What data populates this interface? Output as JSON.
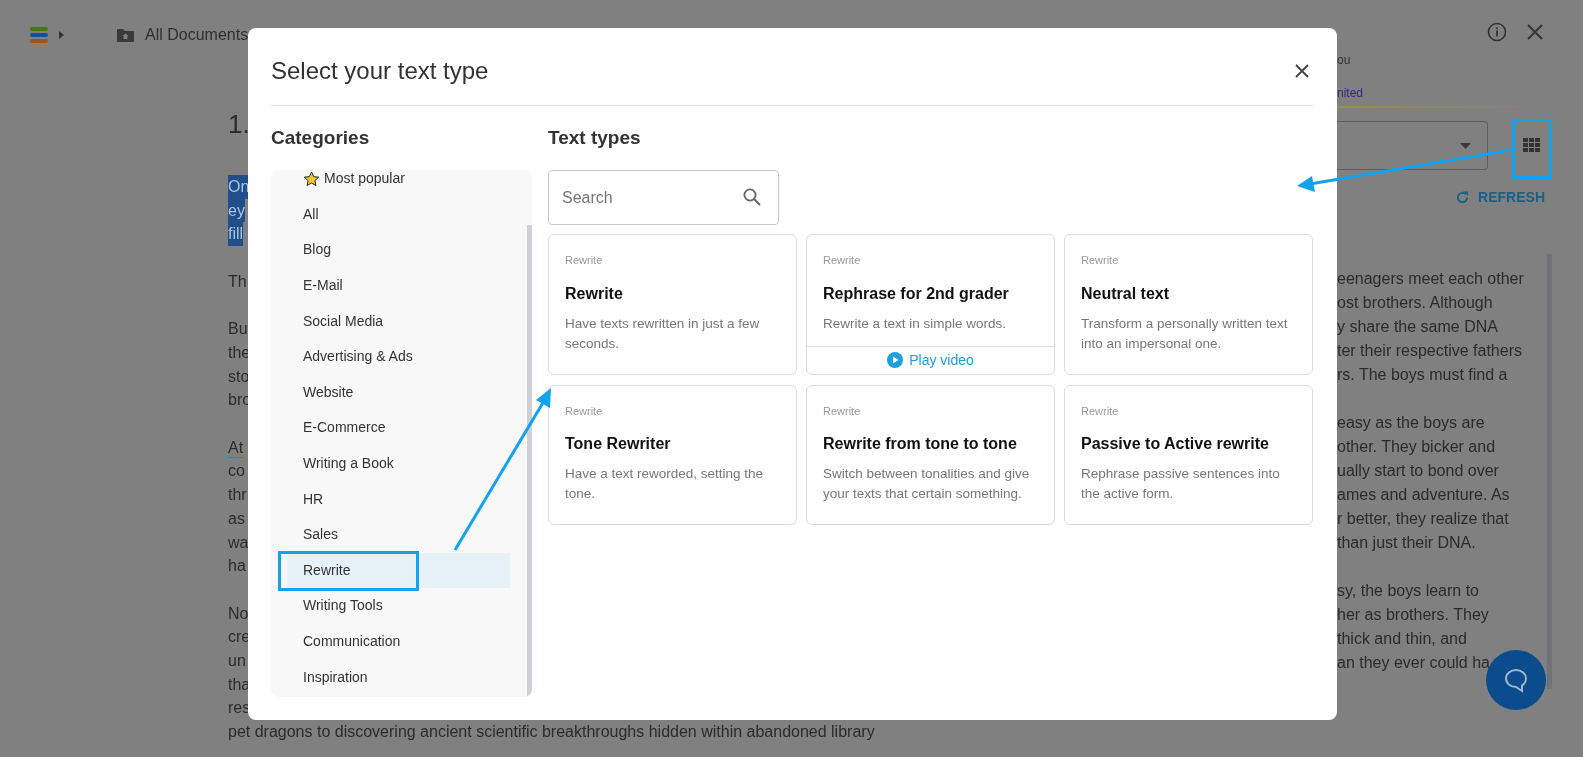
{
  "app_header": {
    "breadcrumb": "All Documents"
  },
  "document": {
    "heading": "1.",
    "paragraphs": [
      {
        "highlighted": true,
        "underline_first_line": false,
        "lines": [
          "On",
          "ey",
          "fill"
        ]
      },
      {
        "highlighted": false,
        "underline_first_line": false,
        "lines": [
          "Th"
        ]
      },
      {
        "highlighted": false,
        "underline_first_line": false,
        "lines": [
          "Bu",
          "the",
          "sto",
          "bro"
        ]
      },
      {
        "highlighted": false,
        "underline_first_line": true,
        "lines": [
          "At",
          "co",
          "thr",
          "as",
          "wa",
          "ha"
        ]
      },
      {
        "highlighted": false,
        "underline_first_line": false,
        "lines": [
          "No",
          "cre",
          "un",
          "tha",
          "res",
          "pet dragons to discovering ancient scientific breakthroughs hidden within abandoned library"
        ]
      }
    ]
  },
  "side_panel": {
    "subtitle": "ou",
    "plan": "nited",
    "refresh_label": "REFRESH",
    "paragraphs": [
      [
        "eenagers meet each other",
        "ost brothers. Although",
        "y share the same DNA",
        "ter their respective fathers",
        "rs. The boys must find a"
      ],
      [
        "easy as the boys are",
        "other. They bicker and",
        "ually start to bond over",
        "ames and adventure. As",
        "r better, they realize that",
        "than just their DNA."
      ],
      [
        "sy, the boys learn to",
        "her as brothers. They",
        "thick and thin, and",
        "an they ever could ha"
      ]
    ]
  },
  "modal": {
    "title": "Select your text type",
    "categories_heading": "Categories",
    "text_types_heading": "Text types",
    "search": {
      "placeholder": "Search"
    },
    "categories": [
      {
        "label": "Most popular",
        "kind": "featured",
        "selected": false
      },
      {
        "label": "All",
        "kind": "plain",
        "selected": false
      },
      {
        "label": "Blog",
        "kind": "plain",
        "selected": false
      },
      {
        "label": "E-Mail",
        "kind": "plain",
        "selected": false
      },
      {
        "label": "Social Media",
        "kind": "plain",
        "selected": false
      },
      {
        "label": "Advertising & Ads",
        "kind": "plain",
        "selected": false
      },
      {
        "label": "Website",
        "kind": "plain",
        "selected": false
      },
      {
        "label": "E-Commerce",
        "kind": "plain",
        "selected": false
      },
      {
        "label": "Writing a Book",
        "kind": "plain",
        "selected": false
      },
      {
        "label": "HR",
        "kind": "plain",
        "selected": false
      },
      {
        "label": "Sales",
        "kind": "plain",
        "selected": false
      },
      {
        "label": "Rewrite",
        "kind": "plain",
        "selected": true
      },
      {
        "label": "Writing Tools",
        "kind": "plain",
        "selected": false
      },
      {
        "label": "Communication",
        "kind": "plain",
        "selected": false
      },
      {
        "label": "Inspiration",
        "kind": "plain",
        "selected": false
      }
    ],
    "cards": [
      {
        "category": "Rewrite",
        "title": "Rewrite",
        "description": "Have texts rewritten in just a few seconds."
      },
      {
        "category": "Rewrite",
        "title": "Rephrase for 2nd grader",
        "description": "Rewrite a text in simple words.",
        "video_label": "Play video"
      },
      {
        "category": "Rewrite",
        "title": "Neutral text",
        "description": "Transform a personally written text into an impersonal one."
      },
      {
        "category": "Rewrite",
        "title": "Tone Rewriter",
        "description": "Have a text reworded, setting the tone."
      },
      {
        "category": "Rewrite",
        "title": "Rewrite from tone to tone",
        "description": "Switch between tonalities and give your texts that certain something."
      },
      {
        "category": "Rewrite",
        "title": "Passive to Active rewrite",
        "description": "Rephrase passive sentences into the active form."
      }
    ]
  }
}
